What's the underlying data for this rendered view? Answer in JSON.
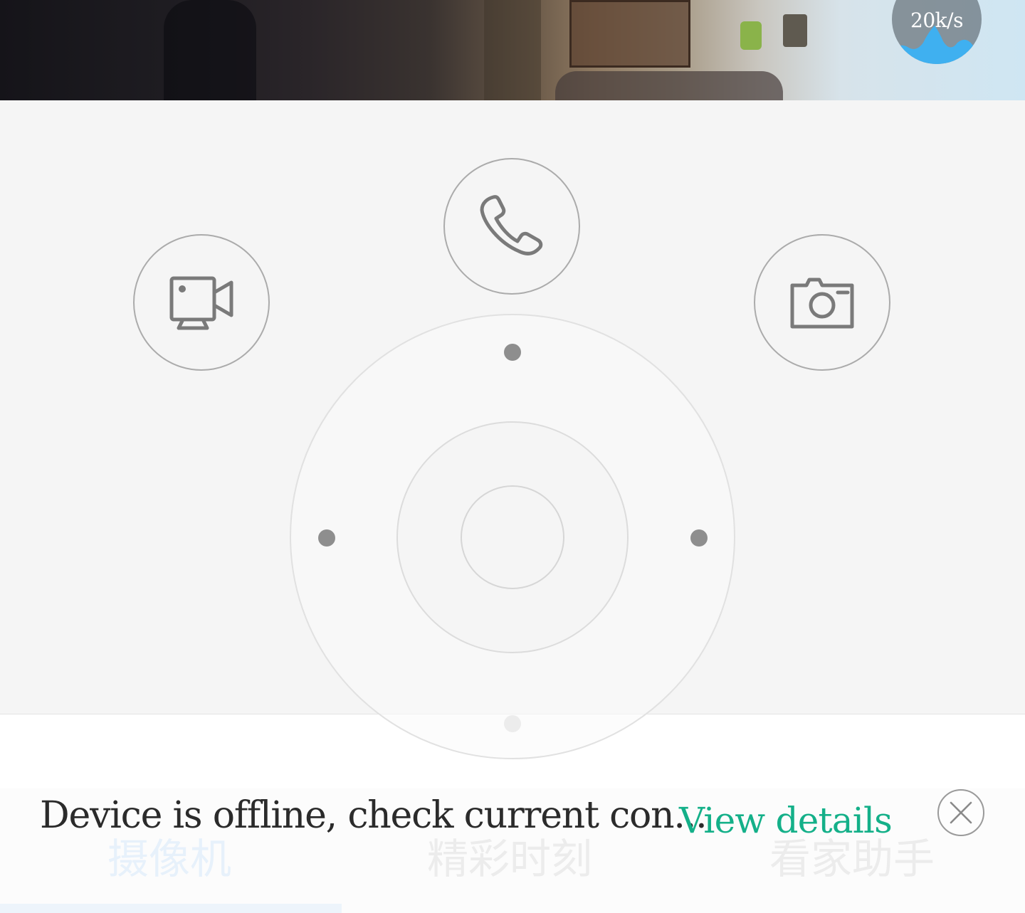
{
  "video": {
    "speed": "20k/s"
  },
  "controls": {
    "record_icon": "video-camera-icon",
    "call_icon": "phone-icon",
    "snapshot_icon": "camera-icon",
    "joystick_icon": "direction-pad"
  },
  "tabs": [
    {
      "label": "摄像机",
      "active": true
    },
    {
      "label": "精彩时刻",
      "active": false
    },
    {
      "label": "看家助手",
      "active": false
    }
  ],
  "banner": {
    "message": "Device is offline, check current con...",
    "action_label": "View details",
    "close_icon": "close-icon"
  },
  "colors": {
    "accent": "#14b089",
    "panel": "#f5f5f5",
    "icon_gray": "#7a7a7a",
    "speed_wave": "#3fb0f0"
  }
}
